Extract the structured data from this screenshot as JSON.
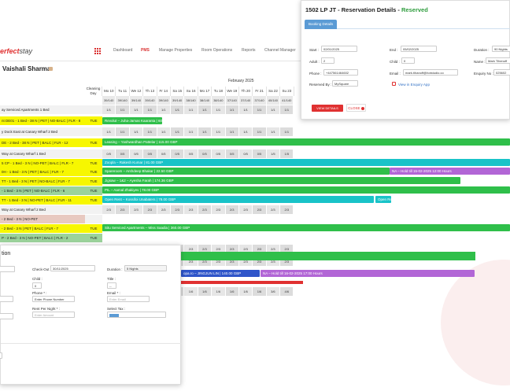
{
  "app": {
    "logo_main": "erfect",
    "logo_suffix": "stay",
    "nav": [
      "Dashboard",
      "PMS",
      "Manage Properties",
      "Room Operations",
      "Reports",
      "Channel Manager"
    ],
    "owner_name": "Vaishali Sharma"
  },
  "calendar": {
    "month": "February 2025",
    "cleaning_header": "Cleaning Day",
    "days": [
      "Mo 10",
      "Tu 11",
      "We 12",
      "Th 13",
      "Fr 14",
      "Sa 15",
      "Su 16",
      "Mo 17",
      "Tu 18",
      "We 19",
      "Th 20",
      "Fr 21",
      "Sa 22",
      "Su 23"
    ],
    "availability": [
      "39/140",
      "39/140",
      "39/140",
      "39/140",
      "39/140",
      "39/140",
      "38/140",
      "38/140",
      "38/140",
      "37/140",
      "37/140",
      "37/140",
      "40/140",
      "41/140"
    ],
    "rows": [
      {
        "label": "ay Serviced Apartments 1 Bed",
        "clean": "",
        "bg": "#f2f2f2"
      },
      {
        "label": "nt DE01 - 1 Bed - 38 N | PET | NO-BALC | FLR - 8",
        "clean": "TUE",
        "bg": "#f7f700"
      },
      {
        "label": "y Dock East at Canary Wharf 2 Bed",
        "clean": "",
        "bg": "#f2f2f2"
      },
      {
        "label": "DE - 2 Bed - 38 N | PET | BALC | FLR - 12",
        "clean": "TUE",
        "bg": "#f7f700"
      },
      {
        "label": "Way at Canary Wharf 1 Bed",
        "clean": "",
        "bg": "#f2f2f2"
      },
      {
        "label": "5 CP - 1 Bed - 3 N | NO-PET | BALC | FLR - 7",
        "clean": "TUE",
        "bg": "#f7f700"
      },
      {
        "label": "0H - 1 Bed - 3 N | PET | BALC | FLR - 7",
        "clean": "TUE",
        "bg": "#f7f700"
      },
      {
        "label": "TT - 1 Bed - 3 N | PET | NO-BALC | FLR - 7",
        "clean": "TUE",
        "bg": "#f7f700"
      },
      {
        "label": "- 1 Bed - 3 N | PET | NO-BALC | FLR - 6",
        "clean": "TUE",
        "bg": "#9bd39b"
      },
      {
        "label": "TT - 1 Bed - 3 N | NO-PET | BALC | FLR - 11",
        "clean": "TUE",
        "bg": "#f7f700"
      },
      {
        "label": "Way at Canary Wharf 2 Bed",
        "clean": "",
        "bg": "#f2f2f2"
      },
      {
        "label": "- 2 Bed - 3 N | NO-PET",
        "clean": "",
        "bg": "#e8c9c0"
      },
      {
        "label": "- 2 Bed - 3 N | PET | BALC | FLR - 7",
        "clean": "TUE",
        "bg": "#f7f700"
      },
      {
        "label": "P - 2 Bed - 3 N | NO-PET | BALC | FLR - 2",
        "clean": "TUE",
        "bg": "#9bd39b"
      }
    ],
    "bars": [
      {
        "text": "Revolut – Juha-Jamas Kaaranta | 60.00 GBP",
        "color": "#2fbf4a"
      },
      {
        "text": "Leasing – Yashwardhan Pattelar | 115.00 GBP",
        "color": "#2fbf4a"
      },
      {
        "text": "Zoopla – Rakesh Kumar | 81.00 GBP",
        "color": "#19c3c8"
      },
      {
        "text": "Spareroom – Arshdeep Bhakar | 22.50 GBP",
        "color": "#2fbf4a"
      },
      {
        "text": "NA – Hold till 15-02-2025 12:00 Hours",
        "color": "#b266d6"
      },
      {
        "text": "Jigsaw – 1&2 – Ayesha Farah | 174.36 GBP",
        "color": "#2fbf4a"
      },
      {
        "text": "PIL – Aamal Zhakiyev | 78.00 GBP",
        "color": "#2fbf4a"
      },
      {
        "text": "Open Rent – Kossifoi Unabaters | 78.00 GBP",
        "color": "#19c3c8"
      },
      {
        "text": "Open Re",
        "color": "#19c3c8"
      },
      {
        "text": "Situ Serviced Apartments – Miss Saadia | 360.00 GBP",
        "color": "#2fbf4a"
      },
      {
        "text": "opa.ro – JINGJUN LIN | 140.00 GBP",
        "color": "#2f55c9"
      },
      {
        "text": "NA – Hold till 16-02-2025 17:00 Hours",
        "color": "#b266d6"
      }
    ],
    "cell_values": {
      "count_row": [
        "1/1",
        "1/1",
        "1/1",
        "1/1",
        "1/1",
        "1/1",
        "1/1",
        "1/1",
        "1/1",
        "1/1",
        "1/1",
        "1/1",
        "1/1",
        "1/1"
      ],
      "dash_row": [
        "0/5",
        "0/5",
        "0/5",
        "0/5",
        "0/5",
        "0/5",
        "0/5",
        "0/5",
        "0/5",
        "0/5",
        "0/5",
        "0/5",
        "1/5",
        "1/5"
      ],
      "pair_row": [
        "2/3",
        "2/3",
        "2/3",
        "2/3",
        "2/3",
        "2/3",
        "2/3",
        "2/3",
        "2/3",
        "2/3",
        "2/3",
        "2/3",
        "2/3",
        "2/3"
      ],
      "six_row": [
        "1/6",
        "1/6",
        "1/6",
        "1/6",
        "1/6",
        "1/6",
        "1/6",
        "1/6",
        "1/6",
        "1/6",
        "1/6",
        "1/6",
        "3/6",
        "4/6"
      ]
    }
  },
  "reservation": {
    "title_prefix": "1502 LP JT",
    "title_mid": " - Reservation Details - ",
    "status": "Reserved",
    "tab": "Booking Details",
    "start_label": "Start :",
    "start_value": "02/01/2025",
    "end_label": "End :",
    "end_value": "05/02/2025",
    "duration_label": "Duration :",
    "duration_value": "90 Nights",
    "adult_label": "Adult :",
    "adult_value": "2",
    "child_label": "Child :",
    "child_value": "0",
    "name_label": "Name :",
    "name_value": "Mark Tihenoff",
    "phone_label": "Phone :",
    "phone_value": "+447561464602",
    "email_label": "Email :",
    "email_value": "mark.tihanoff@hotstudio.co",
    "enquiry_label": "Enquiry No :",
    "enquiry_value": "025602",
    "reserved_by_label": "Reserved By :",
    "reserved_by_value": "MySquare",
    "enquiry_link": "View in Enquiry App",
    "view_details": "VIEW DETAILS",
    "close": "CLOSE"
  },
  "booking": {
    "title": "tion",
    "checkout_label": "Check-Out :",
    "checkout_value": "30/11/2025",
    "duration_label": "Duration :",
    "duration_value": "5 Nights",
    "child_label": "Child :",
    "child_value": "0",
    "title_label": "Title :",
    "title_value": "--",
    "phone_label": "Phone * :",
    "phone_placeholder": "Enter Phone Number",
    "email_label": "Email * :",
    "email_placeholder": "Enter Email",
    "rent_label": "Rent Per Night * :",
    "rent_placeholder": "Enter Amount",
    "tax_label": "Select Tax :"
  },
  "colors": {
    "brand_red": "#e03131",
    "reserved_green": "#2e9c3d",
    "tab_blue": "#5b9bd5"
  }
}
